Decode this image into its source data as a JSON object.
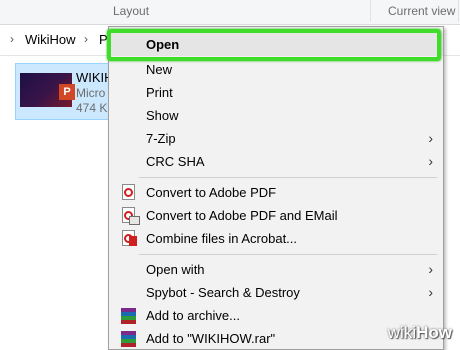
{
  "ribbon": {
    "groups": [
      "Layout",
      "Current view"
    ]
  },
  "address": {
    "crumbs": [
      "WikiHow",
      "P"
    ]
  },
  "file": {
    "name": "WIKIH",
    "type": "Micro",
    "size": "474 K",
    "badge": "P"
  },
  "menu": {
    "items": [
      {
        "label": "Open",
        "icon": "",
        "submenu": false
      },
      {
        "label": "New",
        "icon": "",
        "submenu": false
      },
      {
        "label": "Print",
        "icon": "",
        "submenu": false
      },
      {
        "label": "Show",
        "icon": "",
        "submenu": false
      },
      {
        "label": "7-Zip",
        "icon": "",
        "submenu": true
      },
      {
        "label": "CRC SHA",
        "icon": "",
        "submenu": true
      },
      {
        "label": "Convert to Adobe PDF",
        "icon": "pdf-icon",
        "submenu": false
      },
      {
        "label": "Convert to Adobe PDF and EMail",
        "icon": "pdf-mail-icon",
        "submenu": false
      },
      {
        "label": "Combine files in Acrobat...",
        "icon": "acrobat-combine-icon",
        "submenu": false
      },
      {
        "label": "Open with",
        "icon": "",
        "submenu": true
      },
      {
        "label": "Spybot - Search & Destroy",
        "icon": "",
        "submenu": true
      },
      {
        "label": "Add to archive...",
        "icon": "winrar-icon",
        "submenu": false
      },
      {
        "label": "Add to \"WIKIHOW.rar\"",
        "icon": "winrar-icon",
        "submenu": false
      }
    ],
    "arrow_glyph": "›"
  },
  "watermark": {
    "wiki": "wiki",
    "how": "How"
  },
  "colors": {
    "highlight": "#3fdc2c",
    "selection": "#cce8ff",
    "menu_bg": "#f2f2f2"
  }
}
